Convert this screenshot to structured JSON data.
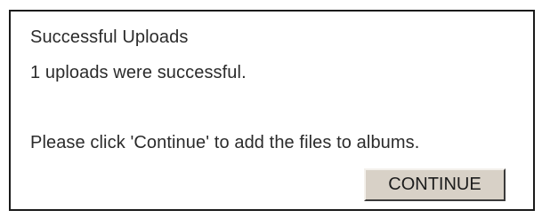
{
  "dialog": {
    "title": "Successful Uploads",
    "status_message": "1 uploads were successful.",
    "instructions": "Please click 'Continue' to add the files to albums.",
    "continue_label": "CONTINUE"
  },
  "colors": {
    "background": "#ffffff",
    "border": "#1a1a1a",
    "button_face": "#d8d1c7",
    "text": "#2b2b2b"
  }
}
